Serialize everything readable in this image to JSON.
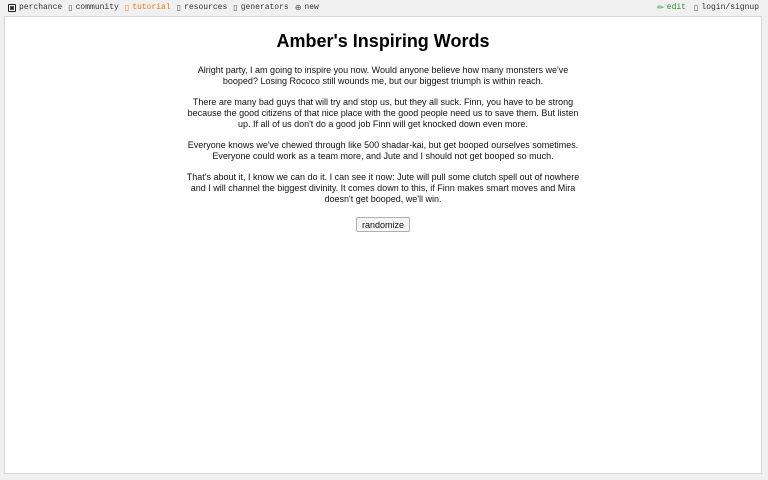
{
  "topbar": {
    "brand": {
      "label": "perchance"
    },
    "nav": [
      {
        "label": "community",
        "glyph": "▯"
      },
      {
        "label": "tutorial",
        "glyph": "▯"
      },
      {
        "label": "resources",
        "glyph": "▯"
      },
      {
        "label": "generators",
        "glyph": "▯"
      },
      {
        "label": "new",
        "glyph": "⊕"
      }
    ],
    "right": [
      {
        "label": "edit",
        "glyph": "✏"
      },
      {
        "label": "login/signup",
        "glyph": "▯"
      }
    ]
  },
  "colors": {
    "tutorial": "#e07a18",
    "edit": "#2f8a2f",
    "background": "#f0f0f0",
    "panel": "#ffffff"
  },
  "icons": {
    "brand": "dice-icon",
    "new": "plus-circle-icon",
    "edit": "pencil-icon"
  },
  "main": {
    "title": "Amber's Inspiring Words",
    "paragraphs": [
      "Alright party, I am going to inspire you now. Would anyone believe how many monsters we've booped? Losing Rococo still wounds me, but our biggest triumph is within reach.",
      "There are many bad guys that will try and stop us, but they all suck. Finn, you have to be strong because the good citizens of that nice place with the good people need us to save them. But listen up. If all of us don't do a good job Finn will get knocked down even more.",
      "Everyone knows we've chewed through like 500 shadar-kai, but get booped ourselves sometimes. Everyone could work as a team more, and Jute and I should not get booped so much.",
      "That's about it, I know we can do it. I can see it now: Jute will pull some clutch spell out of nowhere and I will channel the biggest divinity. It comes down to this, if Finn makes smart moves and Mira doesn't get booped, we'll win."
    ],
    "randomize_label": "randomize"
  }
}
